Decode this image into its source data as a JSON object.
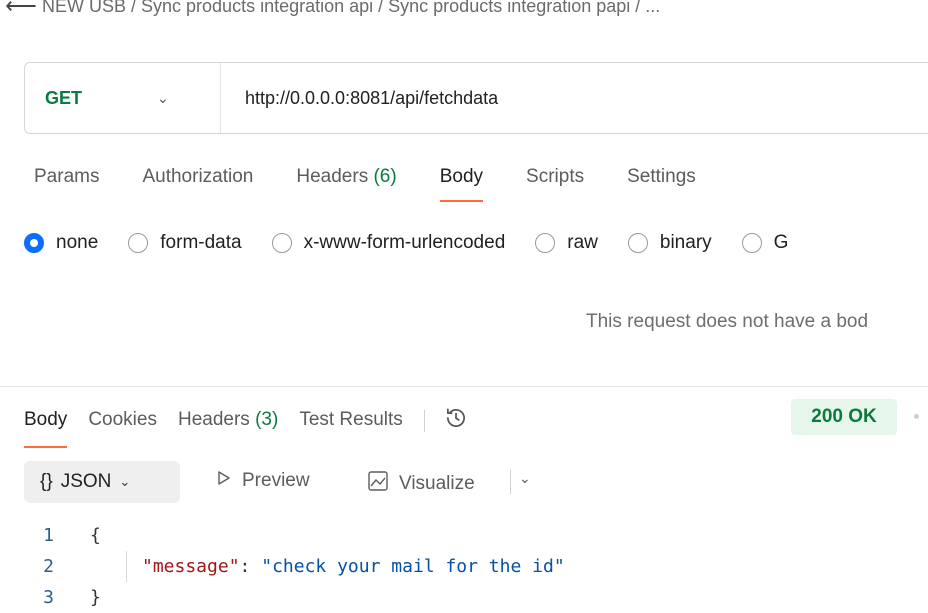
{
  "breadcrumb": {
    "text": "NEW USB / Sync products integration api / Sync products integration papi / ..."
  },
  "request": {
    "method": "GET",
    "url": "http://0.0.0.0:8081/api/fetchdata"
  },
  "request_tabs": {
    "params": "Params",
    "authorization": "Authorization",
    "headers": "Headers",
    "headers_count": "(6)",
    "body": "Body",
    "scripts": "Scripts",
    "settings": "Settings"
  },
  "body_types": {
    "none": "none",
    "form_data": "form-data",
    "urlencoded": "x-www-form-urlencoded",
    "raw": "raw",
    "binary": "binary",
    "graphql": "G"
  },
  "empty_body_message": "This request does not have a bod",
  "response_tabs": {
    "body": "Body",
    "cookies": "Cookies",
    "headers": "Headers",
    "headers_count": "(3)",
    "test_results": "Test Results"
  },
  "status": "200 OK",
  "response_toolbar": {
    "format_braces": "{}",
    "format": "JSON",
    "preview": "Preview",
    "visualize": "Visualize"
  },
  "response_body": {
    "line1": {
      "num": "1",
      "text": "{"
    },
    "line2": {
      "num": "2",
      "key": "\"message\"",
      "colon": ": ",
      "value": "\"check your mail for the id\""
    },
    "line3": {
      "num": "3",
      "text": "}"
    }
  },
  "colors": {
    "accent": "#ff6c37",
    "method_get": "#0b7a3e",
    "radio_selected": "#0d6efd",
    "status_ok_bg": "#e6f6ea"
  }
}
